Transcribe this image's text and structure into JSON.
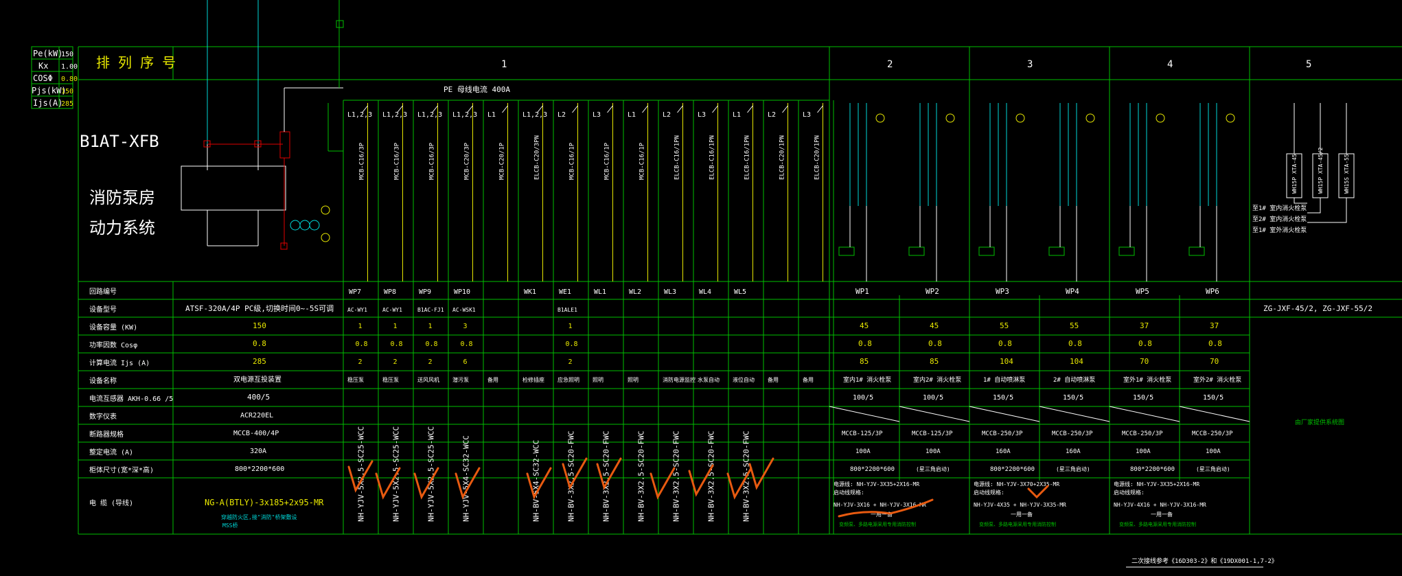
{
  "legend_table": {
    "rows": [
      {
        "label": "Pe(kW)",
        "value": "150"
      },
      {
        "label": "Kx",
        "value": "1.00"
      },
      {
        "label": "COSΦ",
        "value": "0.80"
      },
      {
        "label": "Pjs(kW)",
        "value": "150"
      },
      {
        "label": "Ijs(A)",
        "value": "285"
      }
    ]
  },
  "panel": {
    "arrangement_label": "排 列 序 号",
    "title": "B1AT-XFB",
    "system_line1": "消防泵房",
    "system_line2": "动力系统",
    "busbar_label": "PE    母线电流 400A",
    "column_numbers": [
      "1",
      "2",
      "3",
      "4",
      "5"
    ]
  },
  "row_headers": [
    "回路编号",
    "设备型号",
    "设备容量   (KW)",
    "功率因数     Cosφ",
    "计算电流     Ijs  (A)",
    "设备名称",
    "电流互感器 AKH-0.66 /5",
    "数字仪表",
    "断路器规格",
    "整定电流         (A)",
    "柜体尺寸(宽*深*高)",
    "电  缆 (导线)"
  ],
  "incoming": {
    "model": "ATSF-320A/4P   PC级,切换时间0~-5S可调",
    "capacity": "150",
    "cos": "0.8",
    "current": "285",
    "name": "双电源互投装置",
    "ct": "400/5",
    "meter": "ACR220EL",
    "breaker": "MCCB-400/4P",
    "setting": "320A",
    "size": "800*2200*600",
    "cable": "NG-A(BTLY)-3x185+2x95-MR",
    "note1": "穿越防火区,接\"消防\"桥架敷设",
    "note2": "MSS桥"
  },
  "feeders": [
    {
      "id": "WP7",
      "model": "AC-WY1",
      "kw": "1",
      "cos": "0.8",
      "ijs": "2",
      "name": "稳压泵",
      "breaker_top": "L1,2,3",
      "mcb": "MCB-C16/3P",
      "cable": "NH-YJV-5X2.5-SC25-WCC"
    },
    {
      "id": "WP8",
      "model": "AC-WY1",
      "kw": "1",
      "cos": "0.8",
      "ijs": "2",
      "name": "稳压泵",
      "breaker_top": "L1,2,3",
      "mcb": "MCB-C16/3P",
      "cable": "NH-YJV-5X2.5-SC25-WCC"
    },
    {
      "id": "WP9",
      "model": "B1AC-FJ1",
      "kw": "1",
      "cos": "0.8",
      "ijs": "2",
      "name": "送风风机",
      "breaker_top": "L1,2,3",
      "mcb": "MCB-C16/3P",
      "cable": "NH-YJV-5X2.5-SC25-WCC"
    },
    {
      "id": "WP10",
      "model": "AC-WSK1",
      "kw": "3",
      "cos": "0.8",
      "ijs": "6",
      "name": "潜污泵",
      "breaker_top": "L1,2,3",
      "mcb": "MCB-C20/3P",
      "cable": "NH-YJV-5X4-SC32-WCC"
    },
    {
      "id": "",
      "model": "",
      "kw": "",
      "cos": "",
      "ijs": "",
      "name": "备用",
      "breaker_top": "L1",
      "mcb": "MCB-C20/1P",
      "cable": ""
    },
    {
      "id": "WK1",
      "model": "",
      "kw": "",
      "cos": "",
      "ijs": "",
      "name": "检修插座",
      "breaker_top": "L1,2,3",
      "mcb": "ELCB-C20/3PN",
      "cable": "NH-BV-5X4-SC32-WCC"
    },
    {
      "id": "WE1",
      "model": "B1ALE1",
      "kw": "1",
      "cos": "0.8",
      "ijs": "2",
      "name": "应急照明",
      "breaker_top": "L2",
      "mcb": "MCB-C16/1P",
      "cable": "NH-BV-3X2.5-SC20-FWC"
    },
    {
      "id": "WL1",
      "model": "",
      "kw": "",
      "cos": "",
      "ijs": "",
      "name": "照明",
      "breaker_top": "L3",
      "mcb": "MCB-C16/1P",
      "cable": "NH-BV-3X2.5-SC20-FWC"
    },
    {
      "id": "WL2",
      "model": "",
      "kw": "",
      "cos": "",
      "ijs": "",
      "name": "照明",
      "breaker_top": "L1",
      "mcb": "MCB-C16/1P",
      "cable": "NH-BV-3X2.5-SC20-FWC"
    },
    {
      "id": "WL3",
      "model": "",
      "kw": "",
      "cos": "",
      "ijs": "",
      "name": "消防电源监控",
      "breaker_top": "L2",
      "mcb": "ELCB-C16/1PN",
      "cable": "NH-BV-3X2.5-SC20-FWC"
    },
    {
      "id": "WL4",
      "model": "",
      "kw": "",
      "cos": "",
      "ijs": "",
      "name": "水泵自动",
      "breaker_top": "L3",
      "mcb": "ELCB-C16/1PN",
      "cable": "NH-BV-3X2.5-SC20-FWC"
    },
    {
      "id": "WL5",
      "model": "",
      "kw": "",
      "cos": "",
      "ijs": "",
      "name": "液位自动",
      "breaker_top": "L1",
      "mcb": "ELCB-C16/1PN",
      "cable": "NH-BV-3X2.5-SC20-FWC"
    },
    {
      "id": "",
      "model": "",
      "kw": "",
      "cos": "",
      "ijs": "",
      "name": "备用",
      "breaker_top": "L2",
      "mcb": "ELCB-C20/1PN",
      "cable": ""
    },
    {
      "id": "",
      "model": "",
      "kw": "",
      "cos": "",
      "ijs": "",
      "name": "备用",
      "breaker_top": "L3",
      "mcb": "ELCB-C20/1PN",
      "cable": ""
    }
  ],
  "pumps": [
    {
      "id": "WP1",
      "kw": "45",
      "cos": "0.8",
      "ijs": "85",
      "name": "室内1# 消火栓泵",
      "ct": "100/5",
      "breaker": "MCCB-125/3P",
      "setting": "100A"
    },
    {
      "id": "WP2",
      "kw": "45",
      "cos": "0.8",
      "ijs": "85",
      "name": "室内2# 消火栓泵",
      "ct": "100/5",
      "breaker": "MCCB-125/3P",
      "setting": "100A"
    },
    {
      "id": "WP3",
      "kw": "55",
      "cos": "0.8",
      "ijs": "104",
      "name": "1# 自动喷淋泵",
      "ct": "150/5",
      "breaker": "MCCB-250/3P",
      "setting": "160A"
    },
    {
      "id": "WP4",
      "kw": "55",
      "cos": "0.8",
      "ijs": "104",
      "name": "2# 自动喷淋泵",
      "ct": "150/5",
      "breaker": "MCCB-250/3P",
      "setting": "160A"
    },
    {
      "id": "WP5",
      "kw": "37",
      "cos": "0.8",
      "ijs": "70",
      "name": "室外1# 消火栓泵",
      "ct": "150/5",
      "breaker": "MCCB-250/3P",
      "setting": "100A"
    },
    {
      "id": "WP6",
      "kw": "37",
      "cos": "0.8",
      "ijs": "70",
      "name": "室外2# 消火栓泵",
      "ct": "150/5",
      "breaker": "MCCB-250/3P",
      "setting": "100A"
    }
  ],
  "pump_groups": [
    {
      "size": "800*2200*600",
      "note": "(星三角启动)",
      "cable1": "电源线: NH-YJV-3X35+2X16-MR",
      "cable2": "启动线规格:",
      "cable3": "NH-YJV-3X16 + NH-YJV-3X16-MR",
      "cable4": "一用一备",
      "cable5": "变频泵、多路电源采用专用消防控制"
    },
    {
      "size": "800*2200*600",
      "note": "(星三角启动)",
      "cable1": "电源线: NH-YJV-3X70+2X35-MR",
      "cable2": "启动线规格:",
      "cable3": "NH-YJV-4X35 + NH-YJV-3X35-MR",
      "cable4": "一用一备",
      "cable5": "变频泵、多路电源采用专用消防控制"
    },
    {
      "size": "800*2200*600",
      "note": "(星三角启动)",
      "cable1": "电源线: NH-YJV-3X35+2X16-MR",
      "cable2": "启动线规格:",
      "cable3": "NH-YJV-4X16 + NH-YJV-3X16-MR",
      "cable4": "一用一备",
      "cable5": "变频泵、多路电源采用专用消防控制"
    }
  ],
  "col5": {
    "model": "ZG-JXF-45/2, ZG-JXF-55/2",
    "note": "由厂家提供系统图",
    "labels": [
      "至1# 室内消火栓泵",
      "至2# 室内消火栓泵",
      "至1# 室外消火栓泵"
    ],
    "boxes": [
      "WH15P XTA-45",
      "WH15P XTA-45/2",
      "WH15S XTA-55"
    ]
  },
  "footer_note": "二次接线参考《16D303-2》和《19DX001-1,7-2》",
  "colors": {
    "grid": "#00c000",
    "yellow": "#e8e800",
    "cyan": "#00d8d8",
    "red": "#e00000",
    "white": "#ffffff",
    "orange": "#e85a10"
  }
}
